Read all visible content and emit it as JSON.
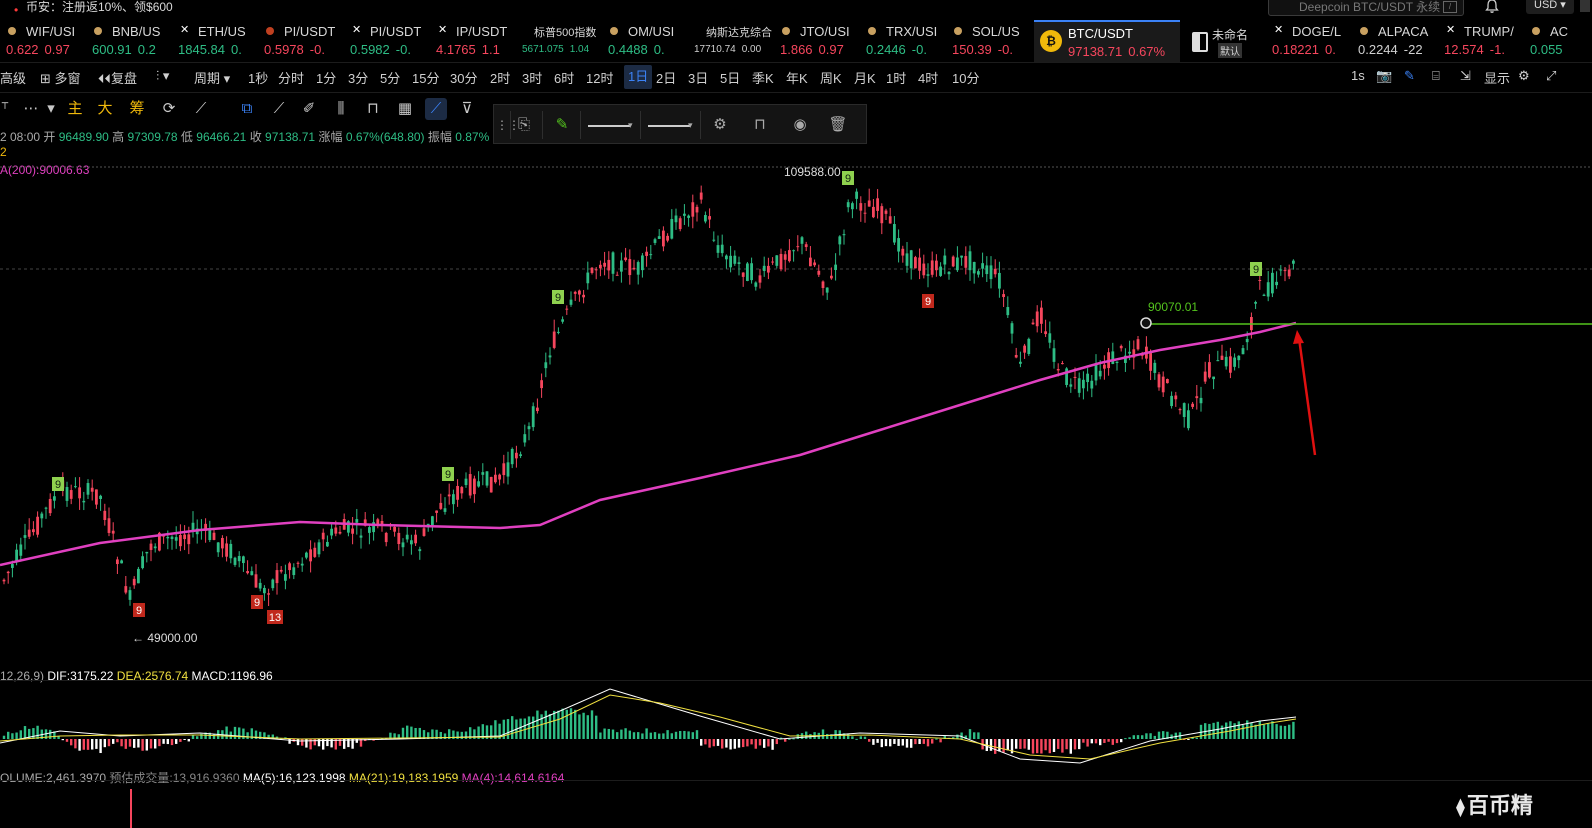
{
  "promo": {
    "text": "币安：注册返10%、领$600"
  },
  "search": {
    "placeholder": "Deepcoin BTC/USDT 永续",
    "shortcut": "/"
  },
  "currency": "USD",
  "tickers": [
    {
      "symbol": "WIF/USI",
      "price": "0.622",
      "change": "0.97",
      "dir": "dn",
      "icon_color": "#c8a060"
    },
    {
      "symbol": "BNB/US",
      "price": "600.91",
      "change": "0.2",
      "dir": "up",
      "icon_color": "#c8a060"
    },
    {
      "symbol": "ETH/US",
      "price": "1845.84",
      "change": "0.",
      "dir": "up",
      "icon": "x"
    },
    {
      "symbol": "PI/USDT",
      "price": "0.5978",
      "change": "-0.",
      "dir": "dn",
      "icon_color": "#c04020"
    },
    {
      "symbol": "PI/USDT",
      "price": "0.5982",
      "change": "-0.",
      "dir": "up",
      "icon": "x"
    },
    {
      "symbol": "IP/USDT",
      "price": "4.1765",
      "change": "1.1",
      "dir": "dn",
      "icon": "x"
    },
    {
      "symbol": "标普500指数",
      "price": "5671.075",
      "change": "1.04",
      "dir": "up",
      "small": true
    },
    {
      "symbol": "OM/USI",
      "price": "0.4488",
      "change": "0.",
      "dir": "up",
      "icon_color": "#c8a060"
    },
    {
      "symbol": "纳斯达克综合",
      "price": "17710.74",
      "change": "0.00",
      "dir": "wh",
      "small": true
    },
    {
      "symbol": "JTO/USI",
      "price": "1.866",
      "change": "0.97",
      "dir": "dn",
      "icon_color": "#c8a060"
    },
    {
      "symbol": "TRX/USI",
      "price": "0.2446",
      "change": "-0.",
      "dir": "up",
      "icon_color": "#c8a060"
    },
    {
      "symbol": "SOL/US",
      "price": "150.39",
      "change": "-0.",
      "dir": "dn",
      "icon_color": "#c8a060"
    },
    {
      "symbol": "BTC/USDT",
      "price": "97138.71",
      "change": "0.67%",
      "dir": "dn",
      "active": true
    },
    {
      "symbol": "未命名",
      "price": "默认",
      "change": "",
      "dir": "wh",
      "layout": true
    },
    {
      "symbol": "DOGE/L",
      "price": "0.18221",
      "change": "0.",
      "dir": "dn",
      "icon": "x"
    },
    {
      "symbol": "ALPACA",
      "price": "0.2244",
      "change": "-22",
      "dir": "wh",
      "icon_color": "#c8a060"
    },
    {
      "symbol": "TRUMP/",
      "price": "12.574",
      "change": "-1.",
      "dir": "dn",
      "icon": "x"
    },
    {
      "symbol": "AC",
      "price": "0.055",
      "change": "",
      "dir": "up",
      "icon_color": "#c8a060"
    }
  ],
  "periods": {
    "left": [
      "高级",
      "多窗",
      "复盘",
      "",
      "周期"
    ],
    "items": [
      "1秒",
      "分时",
      "1分",
      "3分",
      "5分",
      "15分",
      "30分",
      "2时",
      "3时",
      "6时",
      "12时",
      "1日",
      "2日",
      "3日",
      "5日",
      "季K",
      "年K",
      "周K",
      "月K",
      "1时",
      "4时",
      "10分"
    ],
    "active": "1日",
    "right_interval": "1s",
    "display_label": "显示"
  },
  "drawbar": {
    "main": "主",
    "big": "大",
    "chip": "筹"
  },
  "ohlc": {
    "date": "2 08:00",
    "open_label": "开",
    "open": "96489.90",
    "high_label": "高",
    "high": "97309.78",
    "low_label": "低",
    "low": "96466.21",
    "close_label": "收",
    "close": "97138.71",
    "change_label": "涨幅",
    "change": "0.67%(648.80)",
    "amp_label": "振幅",
    "amp": "0.87%"
  },
  "indicator_row": "2",
  "ma200_label": "A(200):90006.63",
  "annotations": {
    "high_price": "109588.00",
    "low_price": "49000.00",
    "hline_price": "90070.01",
    "td_counts": [
      "9",
      "9",
      "9",
      "9",
      "9",
      "9",
      "9",
      "9",
      "13"
    ]
  },
  "macd": {
    "params": "12,26,9)",
    "dif_label": "DIF:",
    "dif": "3175.22",
    "dea_label": "DEA:",
    "dea": "2576.74",
    "macd_label": "MACD:",
    "macd": "1196.96"
  },
  "volume": {
    "label": "OLUME:2,461.3970",
    "est": "预估成交量:13,916.9360",
    "ma5": "MA(5):16,123.1998",
    "ma21": "MA(21):19,183.1959",
    "ma4": "MA(4):14,614.6164"
  },
  "watermark": "百币精",
  "colors": {
    "up": "#2ebd85",
    "down": "#f6465d",
    "ma200": "#e040c0",
    "hline": "#54c41e",
    "arrow": "#e01010",
    "accent": "#3b82f6"
  }
}
